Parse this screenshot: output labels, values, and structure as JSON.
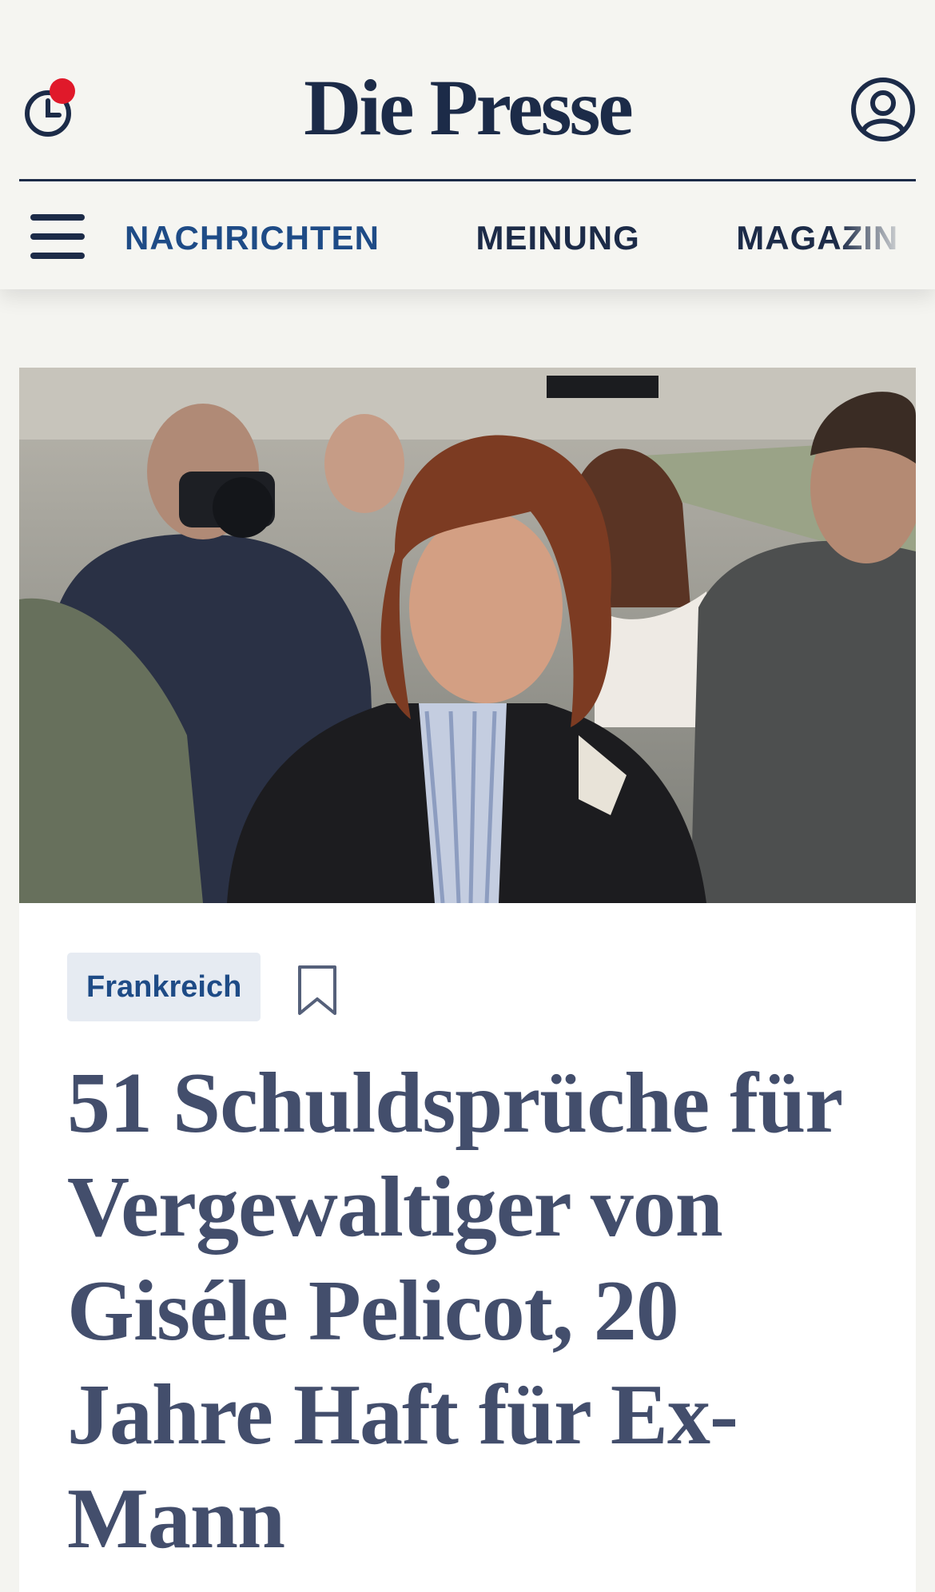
{
  "header": {
    "logo": "Die Presse",
    "history_icon": "clock-notification-icon",
    "account_icon": "user-account-icon",
    "menu_icon": "hamburger-menu-icon",
    "notification_color": "#e0192a",
    "brand_color": "#1c2b48"
  },
  "nav": {
    "items": [
      {
        "label": "NACHRICHTEN",
        "active": true
      },
      {
        "label": "MEINUNG",
        "active": false
      },
      {
        "label": "MAGAZIN",
        "active": false
      }
    ],
    "active_color": "#1e4b86"
  },
  "article": {
    "category": "Frankreich",
    "bookmark_icon": "bookmark-icon",
    "headline": "51 Schuldsprüche für Vergewaltiger von Giséle Pelicot, 20 Jahre Haft für Ex-Mann"
  }
}
